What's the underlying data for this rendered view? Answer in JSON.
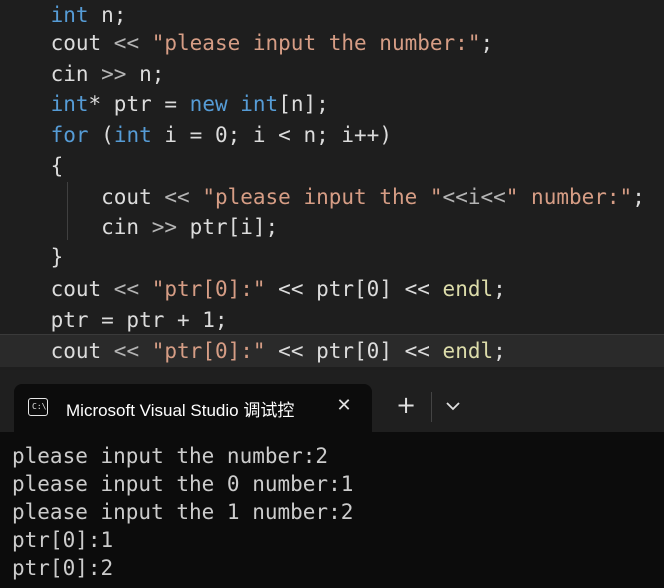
{
  "editor": {
    "lines": [
      [
        {
          "t": "    ",
          "c": ""
        },
        {
          "t": "int",
          "c": "kw"
        },
        {
          "t": " n;",
          "c": ""
        }
      ],
      [
        {
          "t": "    cout ",
          "c": ""
        },
        {
          "t": "<<",
          "c": "op"
        },
        {
          "t": " \"please input the number:\"",
          "c": "str"
        },
        {
          "t": ";",
          "c": ""
        }
      ],
      [
        {
          "t": "    cin ",
          "c": ""
        },
        {
          "t": ">>",
          "c": "op"
        },
        {
          "t": " n;",
          "c": ""
        }
      ],
      [
        {
          "t": "    ",
          "c": ""
        },
        {
          "t": "int",
          "c": "kw"
        },
        {
          "t": "* ptr = ",
          "c": ""
        },
        {
          "t": "new",
          "c": "kw"
        },
        {
          "t": " ",
          "c": ""
        },
        {
          "t": "int",
          "c": "kw"
        },
        {
          "t": "[n];",
          "c": ""
        }
      ],
      [
        {
          "t": "    ",
          "c": ""
        },
        {
          "t": "for",
          "c": "kw"
        },
        {
          "t": " (",
          "c": ""
        },
        {
          "t": "int",
          "c": "kw"
        },
        {
          "t": " i = 0; i < n; i++)",
          "c": ""
        }
      ],
      [
        {
          "t": "    {",
          "c": ""
        }
      ],
      [
        {
          "t": "        cout ",
          "c": ""
        },
        {
          "t": "<<",
          "c": "op"
        },
        {
          "t": " \"please input the \"",
          "c": "str"
        },
        {
          "t": "<<i<<",
          "c": "op"
        },
        {
          "t": "\" number:\"",
          "c": "str"
        },
        {
          "t": ";",
          "c": ""
        }
      ],
      [
        {
          "t": "        cin ",
          "c": ""
        },
        {
          "t": ">>",
          "c": "op"
        },
        {
          "t": " ptr[i];",
          "c": ""
        }
      ],
      [
        {
          "t": "    }",
          "c": ""
        }
      ],
      [
        {
          "t": "    cout ",
          "c": ""
        },
        {
          "t": "<<",
          "c": "op"
        },
        {
          "t": " \"ptr[0]:\"",
          "c": "str"
        },
        {
          "t": " << ptr[0] << ",
          "c": ""
        },
        {
          "t": "endl",
          "c": "fn"
        },
        {
          "t": ";",
          "c": ""
        }
      ],
      [
        {
          "t": "    ptr = ptr + 1;",
          "c": ""
        }
      ],
      [
        {
          "t": "    cout ",
          "c": ""
        },
        {
          "t": "<<",
          "c": "op"
        },
        {
          "t": " \"ptr[0]:\"",
          "c": "str"
        },
        {
          "t": " << ptr[0] << ",
          "c": ""
        },
        {
          "t": "endl",
          "c": "fn"
        },
        {
          "t": ";",
          "c": ""
        }
      ]
    ]
  },
  "terminal": {
    "icon_text": "C:\\",
    "icon_name": "console-icon",
    "tab_title": "Microsoft Visual Studio 调试控",
    "close_glyph": "✕",
    "new_tab_glyph": "+",
    "dropdown_icon": "chevron-down-icon",
    "output": [
      "please input the number:2",
      "please input the 0 number:1",
      "please input the 1 number:2",
      "ptr[0]:1",
      "ptr[0]:2"
    ]
  }
}
